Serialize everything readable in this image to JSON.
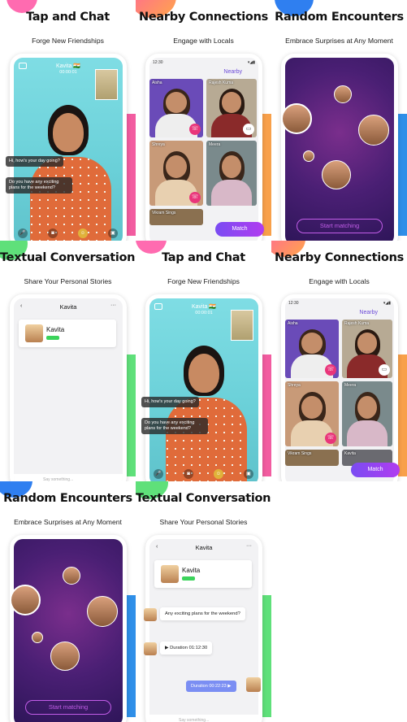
{
  "tiles": {
    "tap_chat": {
      "title": "Tap and Chat",
      "subtitle": "Forge New Friendships",
      "name": "Kavita 🇮🇳",
      "time": "00:00:01",
      "bubble1": "Hi, how's your day going?",
      "bubble2": "Do you have any exciting plans for the weekend?"
    },
    "nearby": {
      "title": "Nearby Connections",
      "subtitle": "Engage with Locals",
      "clock": "12:30",
      "tab": "Nearby",
      "cards": [
        "Aisha",
        "Rajesh Kuma",
        "Shreya",
        "Meera",
        "Vikram Sings",
        "Kavita"
      ],
      "match": "Match"
    },
    "random": {
      "title": "Random Encounters",
      "subtitle": "Embrace Surprises at Any Moment",
      "start": "Start matching"
    },
    "textual": {
      "title": "Textual Conversations",
      "subtitle": "Share Your Personal Stories",
      "header": "Kavita",
      "profile_name": "Kavita",
      "msg1": "Any exciting plans for the weekend?",
      "msg2": "Duration 01:12:30",
      "msg3": "Duration 00:22:23",
      "input": "Say something..."
    }
  },
  "colors": {
    "pink": "#f25ca0",
    "orange": "#f8a04a",
    "green": "#5fe07a",
    "blue": "#2f7ff0",
    "purple": "#7a4cf2"
  }
}
